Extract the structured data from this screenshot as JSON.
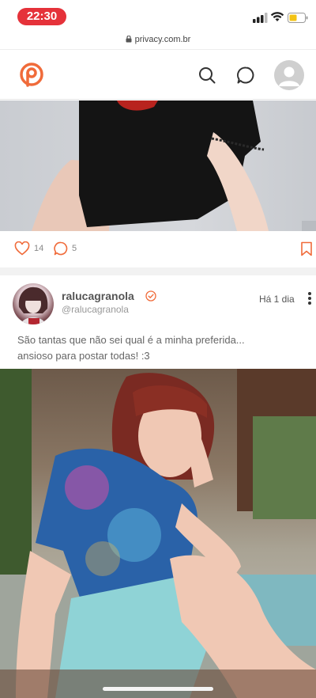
{
  "status_bar": {
    "time": "22:30",
    "battery_color": "#f3c316"
  },
  "browser": {
    "url": "privacy.com.br"
  },
  "header": {
    "brand_color": "#f06b3a"
  },
  "post1": {
    "likes": "14",
    "comments": "5"
  },
  "post2": {
    "display_name": "ralucagranola",
    "handle": "@ralucagranola",
    "time_ago": "Há 1 dia",
    "caption_lines": [
      "São tantas que não sei qual é a minha preferida...",
      "ansioso para postar todas! :3"
    ]
  },
  "colors": {
    "accent": "#f06b3a",
    "time_pill": "#e5323a"
  },
  "icons": [
    "lock-icon",
    "search-icon",
    "message-icon",
    "user-avatar-icon",
    "heart-icon",
    "comment-icon",
    "bookmark-icon",
    "verified-icon",
    "more-vertical-icon"
  ]
}
